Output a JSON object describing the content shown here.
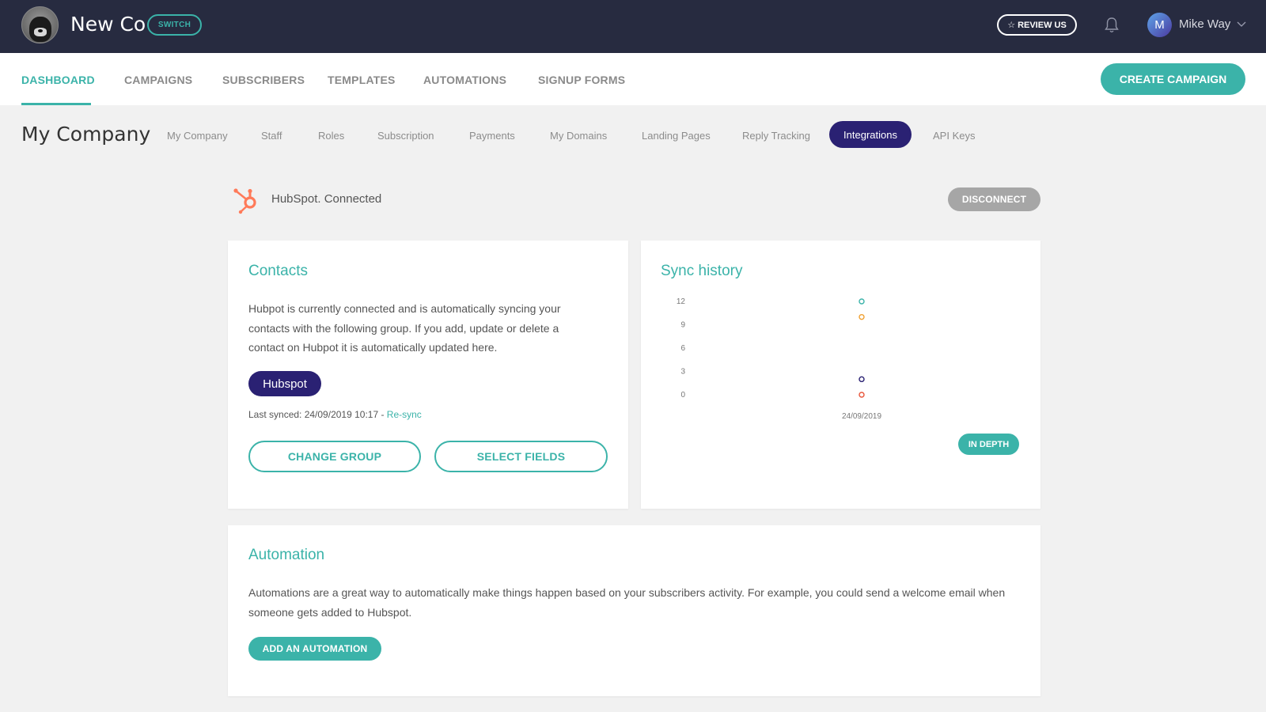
{
  "header": {
    "company_name": "New Co",
    "switch_label": "SWITCH",
    "review_label": "REVIEW US",
    "user_name": "Mike Way",
    "user_initial": "M"
  },
  "nav": {
    "items": [
      "DASHBOARD",
      "CAMPAIGNS",
      "SUBSCRIBERS",
      "TEMPLATES",
      "AUTOMATIONS",
      "SIGNUP FORMS"
    ],
    "active": "DASHBOARD",
    "create_label": "CREATE CAMPAIGN"
  },
  "subnav": {
    "page_title": "My Company",
    "items": [
      "My Company",
      "Staff",
      "Roles",
      "Subscription",
      "Payments",
      "My Domains",
      "Landing Pages",
      "Reply Tracking",
      "Integrations",
      "API Keys"
    ],
    "active": "Integrations"
  },
  "integration": {
    "status": "HubSpot. Connected",
    "disconnect_label": "DISCONNECT"
  },
  "contacts": {
    "title": "Contacts",
    "description": "Hubpot is currently connected and is automatically syncing your contacts with the following group. If you add, update or delete a contact on Hubpot it is automatically updated here.",
    "group_label": "Hubspot",
    "last_synced": "Last synced: 24/09/2019 10:17 - ",
    "resync_label": "Re-sync",
    "change_group_label": "CHANGE GROUP",
    "select_fields_label": "SELECT FIELDS"
  },
  "sync_history": {
    "title": "Sync history",
    "in_depth_label": "IN DEPTH"
  },
  "automation": {
    "title": "Automation",
    "description": "Automations are a great way to automatically make things happen based on your subscribers activity. For example, you could send a welcome email when someone gets added to Hubspot.",
    "add_label": "ADD AN AUTOMATION"
  },
  "chart_data": {
    "type": "scatter",
    "x": [
      "24/09/2019"
    ],
    "yticks": [
      0,
      3,
      6,
      9,
      12
    ],
    "ylim": [
      0,
      12
    ],
    "series": [
      {
        "values": [
          12
        ],
        "color": "#3bb3a9"
      },
      {
        "values": [
          10
        ],
        "color": "#f0a030"
      },
      {
        "values": [
          2
        ],
        "color": "#2a2173"
      },
      {
        "values": [
          0
        ],
        "color": "#e8553a"
      }
    ]
  },
  "colors": {
    "accent": "#3bb3a9",
    "dark": "#272b40",
    "purple": "#2a2173",
    "hubspot": "#ff7a59"
  }
}
